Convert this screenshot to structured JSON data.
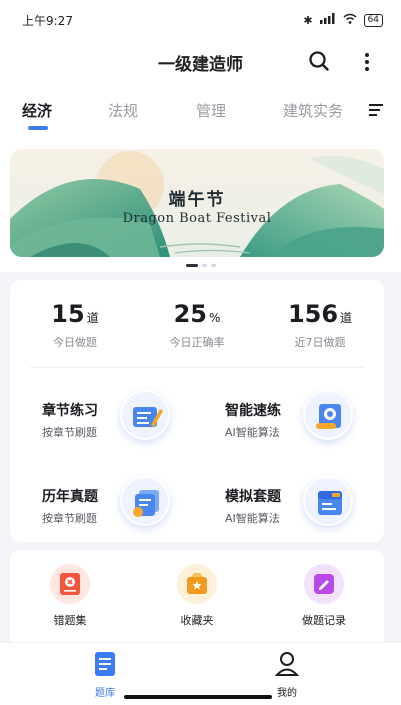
{
  "status_bar": {
    "time": "上午9:27",
    "signal": "⁵ᴳ",
    "battery": "64"
  },
  "app_bar": {
    "title": "一级建造师"
  },
  "tabs": [
    {
      "label": "经济",
      "active": true
    },
    {
      "label": "法规",
      "active": false
    },
    {
      "label": "管理",
      "active": false
    },
    {
      "label": "建筑实务",
      "active": false
    }
  ],
  "banner": {
    "title": "端午节",
    "subtitle": "Dragon Boat Festival",
    "dots": 3,
    "active_dot": 0
  },
  "stats": [
    {
      "value": "15",
      "unit": "道",
      "label": "今日做题"
    },
    {
      "value": "25",
      "unit": "%",
      "label": "今日正确率"
    },
    {
      "value": "156",
      "unit": "道",
      "label": "近7日做题"
    }
  ],
  "features": [
    {
      "title": "章节练习",
      "subtitle": "按章节刷题",
      "icon": "chapter-practice-icon"
    },
    {
      "title": "智能速练",
      "subtitle": "AI智能算法",
      "icon": "smart-practice-icon"
    },
    {
      "title": "历年真题",
      "subtitle": "按章节刷题",
      "icon": "past-exams-icon"
    },
    {
      "title": "模拟套题",
      "subtitle": "AI智能算法",
      "icon": "mock-exams-icon"
    }
  ],
  "tools": [
    {
      "label": "错题集",
      "icon": "wrong-questions-icon",
      "color": "#f4553c"
    },
    {
      "label": "收藏夹",
      "icon": "favorites-icon",
      "color": "#f29a1e"
    },
    {
      "label": "做题记录",
      "icon": "records-icon",
      "color": "#b94ae8"
    }
  ],
  "bottom_nav": [
    {
      "label": "题库",
      "icon": "question-bank-icon",
      "active": true
    },
    {
      "label": "我的",
      "icon": "profile-icon",
      "active": false
    }
  ],
  "colors": {
    "accent": "#3a7bf1"
  }
}
